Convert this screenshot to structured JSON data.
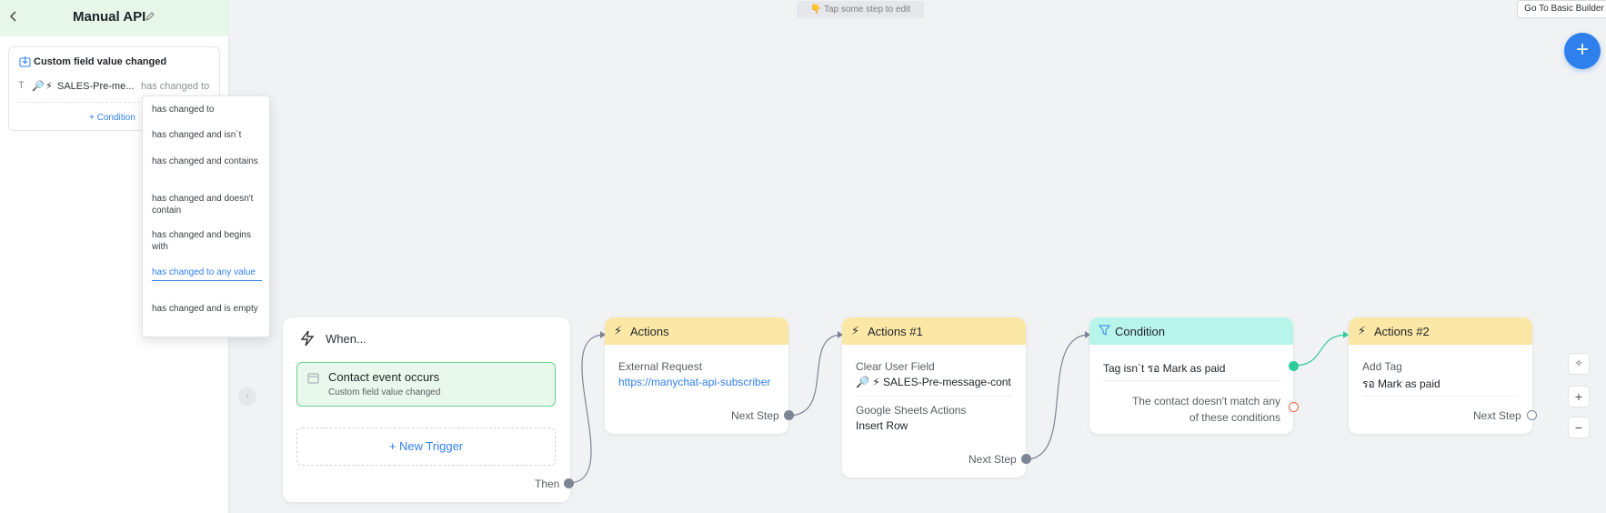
{
  "sidebar": {
    "title": "Manual API",
    "back_icon": "chevron-left-icon",
    "trigger": {
      "title": "Custom field value changed",
      "field_label": "SALES-Pre-me...",
      "operator_placeholder": "has changed to",
      "add_condition": "+ Condition"
    }
  },
  "dropdown": {
    "options": [
      "has changed to",
      "has changed and isn`t",
      "has changed and contains",
      "has changed and doesn't contain",
      "has changed and begins with",
      "has changed to any value",
      "has changed and is empty"
    ],
    "selected_index": 5
  },
  "toolbar": {
    "hint": "👇 Tap some step to edit",
    "basic_builder": "Go To Basic Builder",
    "add_button": "+"
  },
  "canvas": {
    "when": {
      "title": "When...",
      "event_title": "Contact event occurs",
      "event_sub": "Custom field value changed",
      "new_trigger": "+ New Trigger",
      "then": "Then"
    },
    "actions": {
      "title": "Actions",
      "label": "External Request",
      "value": "https://manychat-api-subscriber",
      "next": "Next Step"
    },
    "actions1": {
      "title": "Actions #1",
      "label1": "Clear User Field",
      "value1": "🔎 ⚡ SALES-Pre-message-cont",
      "label2": "Google Sheets Actions",
      "value2": "Insert Row",
      "next": "Next Step"
    },
    "condition": {
      "title": "Condition",
      "rule": "Tag isn`t รอ Mark as paid",
      "else": "The contact doesn't match any of these conditions"
    },
    "actions2": {
      "title": "Actions #2",
      "label": "Add Tag",
      "value": "รอ Mark as paid",
      "next": "Next Step"
    }
  },
  "colors": {
    "accent": "#2f80ed",
    "action_header": "#fbe7a6",
    "condition_header": "#b7f4ea",
    "trigger_green": "#69cf8a"
  }
}
